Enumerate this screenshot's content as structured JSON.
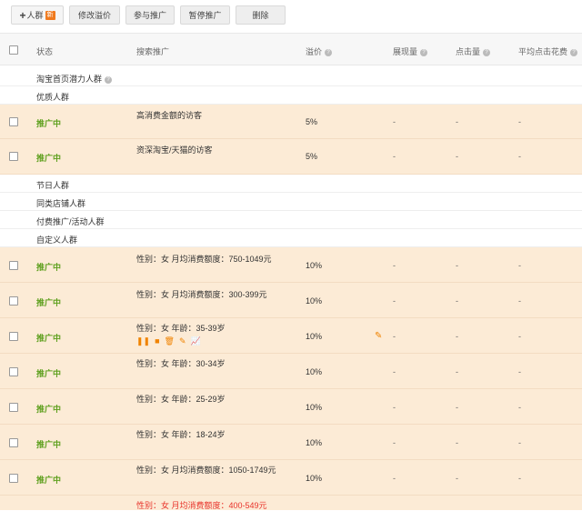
{
  "toolbar": {
    "add_label": "人群",
    "add_badge": "新",
    "modify_price": "修改溢价",
    "join_promo": "参与推广",
    "pause_promo": "暂停推广",
    "delete": "删除"
  },
  "columns": {
    "status": "状态",
    "search": "搜索推广",
    "premium": "溢价",
    "impressions": "展现量",
    "clicks": "点击量",
    "avg_cost": "平均点击花费"
  },
  "groups": [
    "淘宝首页潜力人群",
    "优质人群",
    "节日人群",
    "同类店铺人群",
    "付费推广/活动人群",
    "自定义人群"
  ],
  "quality_rows": [
    {
      "status": "推广中",
      "name": "高消费金额的访客",
      "premium": "5%",
      "impressions": "-",
      "clicks": "-",
      "avg": "-"
    },
    {
      "status": "推广中",
      "name": "资深淘宝/天猫的访客",
      "premium": "5%",
      "impressions": "-",
      "clicks": "-",
      "avg": "-"
    }
  ],
  "custom_rows": [
    {
      "status": "推广中",
      "name": "性别：女 月均消费额度：750-1049元",
      "premium": "10%",
      "impressions": "-",
      "clicks": "-",
      "avg": "-"
    },
    {
      "status": "推广中",
      "name": "性别：女 月均消费额度：300-399元",
      "premium": "10%",
      "impressions": "-",
      "clicks": "-",
      "avg": "-"
    },
    {
      "status": "推广中",
      "name": "性别：女 年龄：35-39岁",
      "premium": "10%",
      "impressions": "-",
      "clicks": "-",
      "avg": "-"
    },
    {
      "status": "推广中",
      "name": "性别：女 年龄：30-34岁",
      "premium": "10%",
      "impressions": "-",
      "clicks": "-",
      "avg": "-"
    },
    {
      "status": "推广中",
      "name": "性别：女 年龄：25-29岁",
      "premium": "10%",
      "impressions": "-",
      "clicks": "-",
      "avg": "-"
    },
    {
      "status": "推广中",
      "name": "性别：女 年龄：18-24岁",
      "premium": "10%",
      "impressions": "-",
      "clicks": "-",
      "avg": "-"
    },
    {
      "status": "推广中",
      "name": "性别：女 月均消费额度：1050-1749元",
      "premium": "10%",
      "impressions": "-",
      "clicks": "-",
      "avg": "-"
    }
  ],
  "partial_row": {
    "name": "性别：女 月均消费额度：400-549元"
  },
  "row_icons": [
    "pause-icon",
    "stop-icon",
    "trash-icon",
    "edit-icon",
    "chart-icon"
  ],
  "colors": {
    "highlight": "#fcebd6",
    "status_green": "#5fa01f",
    "accent_orange": "#f08300",
    "red": "#e8332a"
  }
}
